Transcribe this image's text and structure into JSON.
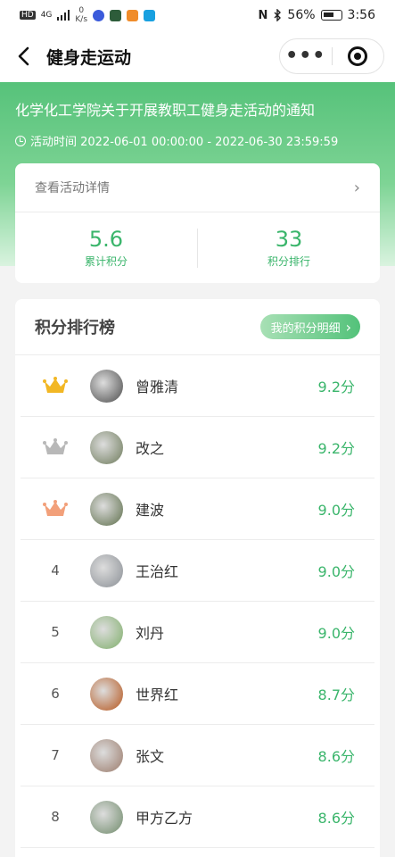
{
  "status_bar": {
    "left_hd": "HD",
    "left_net": "4G",
    "speed_value": "0",
    "speed_unit": "K/s",
    "battery_pct": "56%",
    "time": "3:56"
  },
  "nav": {
    "title": "健身走运动",
    "more_icon": "•••"
  },
  "banner": {
    "title": "化学化工学院关于开展教职工健身走活动的通知",
    "time_text": "活动时间 2022-06-01 00:00:00 - 2022-06-30 23:59:59"
  },
  "detail": {
    "link_label": "查看活动详情",
    "chevron": "›"
  },
  "stats": {
    "points_value": "5.6",
    "points_label": "累计积分",
    "rank_value": "33",
    "rank_label": "积分排行"
  },
  "leaderboard": {
    "title": "积分排行榜",
    "my_detail_label": "我的积分明细",
    "my_detail_chevron": "›",
    "items": [
      {
        "rank": "1",
        "name": "曾雅清",
        "score": "9.2分",
        "medal": "gold"
      },
      {
        "rank": "2",
        "name": "改之",
        "score": "9.2分",
        "medal": "silver"
      },
      {
        "rank": "3",
        "name": "建波",
        "score": "9.0分",
        "medal": "bronze"
      },
      {
        "rank": "4",
        "name": "王治红",
        "score": "9.0分"
      },
      {
        "rank": "5",
        "name": "刘丹",
        "score": "9.0分"
      },
      {
        "rank": "6",
        "name": "世界红",
        "score": "8.7分"
      },
      {
        "rank": "7",
        "name": "张文",
        "score": "8.6分"
      },
      {
        "rank": "8",
        "name": "甲方乙方",
        "score": "8.6分"
      }
    ]
  },
  "colors": {
    "accent": "#3ab56b",
    "gold": "#f2b724",
    "silver": "#b8b8b8",
    "bronze": "#f2a07a"
  }
}
